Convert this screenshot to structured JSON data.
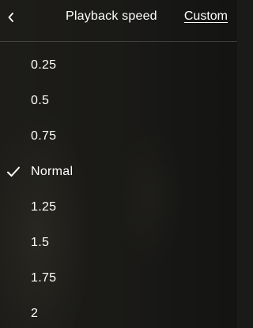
{
  "header": {
    "back_icon": "chevron-left-icon",
    "title": "Playback speed",
    "custom_label": "Custom"
  },
  "speeds": [
    {
      "label": "0.25",
      "selected": false
    },
    {
      "label": "0.5",
      "selected": false
    },
    {
      "label": "0.75",
      "selected": false
    },
    {
      "label": "Normal",
      "selected": true
    },
    {
      "label": "1.25",
      "selected": false
    },
    {
      "label": "1.5",
      "selected": false
    },
    {
      "label": "1.75",
      "selected": false
    },
    {
      "label": "2",
      "selected": false
    }
  ],
  "selected_icon": "checkmark-icon",
  "colors": {
    "text": "#ffffff",
    "divider": "#ffffff2e"
  }
}
